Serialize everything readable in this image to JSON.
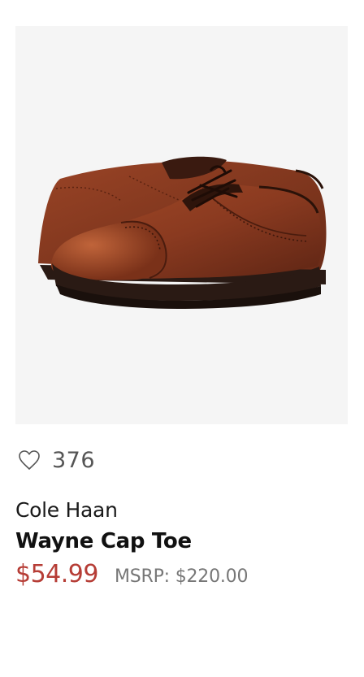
{
  "product": {
    "image_alt": "Brown leather cap toe oxford shoes",
    "favorites_count": "376",
    "brand": "Cole Haan",
    "name": "Wayne Cap Toe",
    "price": "$54.99",
    "msrp": "MSRP: $220.00"
  },
  "icons": {
    "favorite": "heart-outline-icon"
  },
  "colors": {
    "sale_price": "#b63d36",
    "image_background": "#f5f5f5",
    "leather": "#8b3e24",
    "sole": "#2a1a14"
  }
}
